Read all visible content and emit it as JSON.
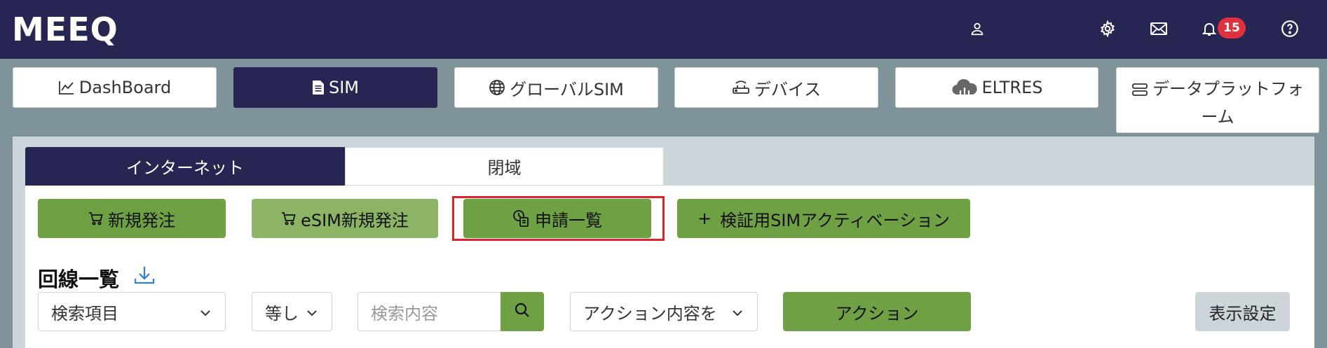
{
  "header": {
    "logo": "MEEQ",
    "notification_count": "15",
    "icons": [
      "user-icon",
      "gear-icon",
      "mail-icon",
      "bell-icon",
      "help-icon"
    ]
  },
  "nav_tabs": [
    {
      "label": "DashBoard",
      "icon": "chart-line-icon"
    },
    {
      "label": "SIM",
      "icon": "sim-card-icon",
      "active": true
    },
    {
      "label": "グローバルSIM",
      "icon": "globe-icon"
    },
    {
      "label": "デバイス",
      "icon": "router-icon"
    },
    {
      "label": "ELTRES",
      "icon": "cloud-icon"
    },
    {
      "label_line1": "データプラットフォ",
      "label_line2": "ーム",
      "icon": "server-icon"
    }
  ],
  "sub_tabs": [
    {
      "label": "インターネット",
      "active": true
    },
    {
      "label": "閉域",
      "active": false
    }
  ],
  "actions": {
    "new_order": "新規発注",
    "esim_new_order": "eSIM新規発注",
    "request_list": "申請一覧",
    "activation": "検証用SIMアクティベーション",
    "activation_prefix": "+"
  },
  "line_list": {
    "title": "回線一覧",
    "search_field": "検索項目",
    "operator": "等し",
    "search_placeholder": "検索内容",
    "action_select": "アクション内容を",
    "action_button": "アクション",
    "display_settings": "表示設定"
  },
  "colors": {
    "header_bg": "#272652",
    "accent_green": "#70a044",
    "badge_red": "#e0313e",
    "highlight_red": "#e0202b"
  }
}
